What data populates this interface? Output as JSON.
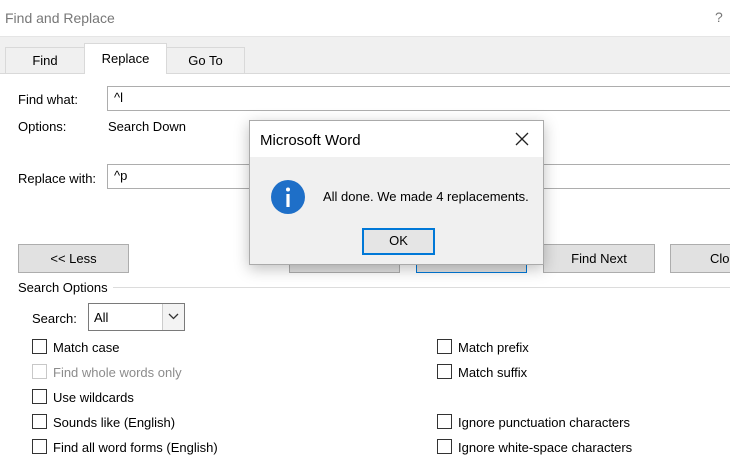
{
  "window": {
    "title": "Find and Replace",
    "help": "?"
  },
  "tabs": [
    {
      "label": "Find",
      "active": false
    },
    {
      "label": "Replace",
      "active": true
    },
    {
      "label": "Go To",
      "active": false
    }
  ],
  "form": {
    "find_label": "Find what:",
    "find_value": "^l",
    "options_label": "Options:",
    "options_value": "Search Down",
    "replace_label": "Replace with:",
    "replace_value": "^p"
  },
  "buttons": {
    "less": "<< Less",
    "find_next": "Find Next",
    "close": "Clo"
  },
  "search_options": {
    "group_label": "Search Options",
    "search_label": "Search:",
    "search_value": "All",
    "left": [
      {
        "label": "Match case",
        "checked": false,
        "disabled": false
      },
      {
        "label": "Find whole words only",
        "checked": false,
        "disabled": true
      },
      {
        "label": "Use wildcards",
        "checked": false,
        "disabled": false
      },
      {
        "label": "Sounds like (English)",
        "checked": false,
        "disabled": false
      },
      {
        "label": "Find all word forms (English)",
        "checked": false,
        "disabled": false
      }
    ],
    "right": [
      {
        "label": "Match prefix",
        "checked": false
      },
      {
        "label": "Match suffix",
        "checked": false
      },
      {
        "label": "Ignore punctuation characters",
        "checked": false
      },
      {
        "label": "Ignore white-space characters",
        "checked": false
      }
    ]
  },
  "dialog": {
    "title": "Microsoft Word",
    "message": "All done. We made 4 replacements.",
    "ok_label": "OK",
    "icon": "info-icon",
    "accent": "#0078d7",
    "icon_color": "#1e6fc8"
  }
}
